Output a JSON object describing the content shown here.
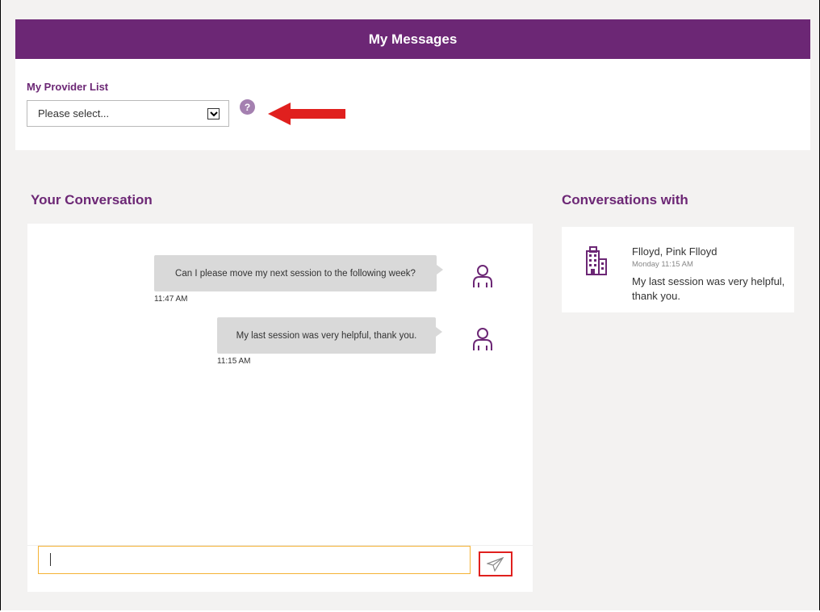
{
  "header": {
    "title": "My Messages"
  },
  "provider": {
    "label": "My Provider List",
    "select_value": "Please select...",
    "help_icon": "question-circle-icon",
    "help_text": "?"
  },
  "conversation": {
    "title": "Your Conversation",
    "messages": [
      {
        "text": "Can I please move my next session to the following week?",
        "time": "11:47 AM",
        "avatar_icon": "user-outline-icon"
      },
      {
        "text": "My last session was very helpful, thank you.",
        "time": "11:15 AM",
        "avatar_icon": "user-outline-icon"
      }
    ],
    "input_value": "",
    "send_icon": "paper-plane-icon"
  },
  "conversations_with": {
    "title": "Conversations with",
    "items": [
      {
        "name": "Flloyd, Pink Flloyd",
        "time": "Monday 11:15 AM",
        "preview": "My last session was very helpful, thank you.",
        "icon": "building-icon"
      }
    ]
  },
  "colors": {
    "brand": "#6c2775",
    "accent_border": "#f5b335",
    "annotation": "#e0201e"
  }
}
